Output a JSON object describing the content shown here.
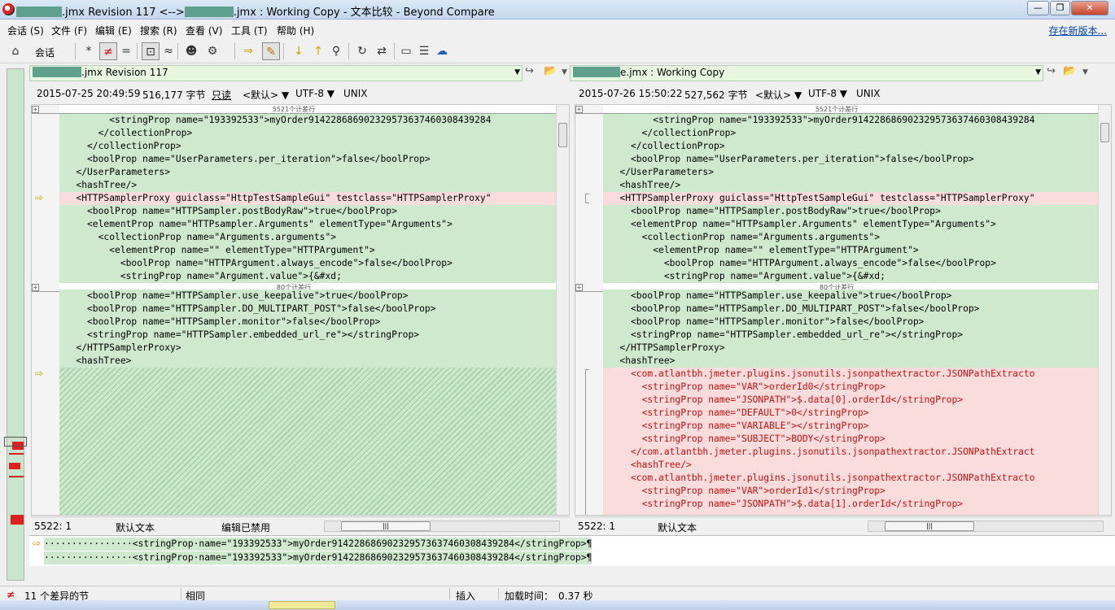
{
  "window": {
    "title": ".jmx Revision 117 <-->",
    "title_mid": ".jmx : Working Copy - 文本比较 - Beyond Compare",
    "btn_min": "—",
    "btn_max": "❐",
    "btn_close": "✕"
  },
  "menu": {
    "items": [
      "会话 (S)",
      "文件 (F)",
      "编辑 (E)",
      "搜索 (R)",
      "查看 (V)",
      "工具 (T)",
      "帮助 (H)"
    ],
    "update_link": "存在新版本..."
  },
  "toolbar": {
    "session_label": "会话",
    "icons": {
      "home": "⌂",
      "all": "*",
      "diffs": "≠",
      "same": "=",
      "context": "⊡",
      "minor": "≈",
      "user": "☻",
      "rules": "⚙",
      "next_section": "⇒",
      "edit": "✎",
      "next_diff": "↓",
      "prev_diff": "↑",
      "find": "⚲",
      "refresh": "↻",
      "swap": "⇄",
      "page1": "▭",
      "page2": "☰",
      "web": "☁"
    }
  },
  "left": {
    "path": ".jmx Revision 117",
    "date": "2015-07-25 20:49:59",
    "size": "516,177 字节",
    "readonly": "只读",
    "format": "<默认>",
    "encoding": "UTF-8",
    "lineend": "UNIX",
    "fold_top": "5521个计差行",
    "fold_mid": "80个计差行",
    "lines": [
      "         <stringProp name=\"193392533\">myOrder914228686902329573637460308439284",
      "       </collectionProp>",
      "     </collectionProp>",
      "     <boolProp name=\"UserParameters.per_iteration\">false</boolProp>",
      "   </UserParameters>",
      "   <hashTree/>",
      "   <HTTPSamplerProxy guiclass=\"HttpTestSampleGui\" testclass=\"HTTPSamplerProxy\"",
      "     <boolProp name=\"HTTPSampler.postBodyRaw\">true</boolProp>",
      "     <elementProp name=\"HTTPsampler.Arguments\" elementType=\"Arguments\">",
      "       <collectionProp name=\"Arguments.arguments\">",
      "         <elementProp name=\"\" elementType=\"HTTPArgument\">",
      "           <boolProp name=\"HTTPArgument.always_encode\">false</boolProp>",
      "           <stringProp name=\"Argument.value\">{&#xd;",
      "     <boolProp name=\"HTTPSampler.use_keepalive\">true</boolProp>",
      "     <boolProp name=\"HTTPSampler.DO_MULTIPART_POST\">false</boolProp>",
      "     <boolProp name=\"HTTPSampler.monitor\">false</boolProp>",
      "     <stringProp name=\"HTTPSampler.embedded_url_re\"></stringProp>",
      "   </HTTPSamplerProxy>",
      "   <hashTree>"
    ],
    "status_pos": "5522: 1",
    "status_mode": "默认文本",
    "status_edit": "编辑已禁用"
  },
  "right": {
    "path": "e.jmx : Working Copy",
    "date": "2015-07-26 15:50:22",
    "size": "527,562 字节",
    "format": "<默认>",
    "encoding": "UTF-8",
    "lineend": "UNIX",
    "fold_top": "5521个计差行",
    "fold_mid": "80个计差行",
    "lines": [
      "         <stringProp name=\"193392533\">myOrder914228686902329573637460308439284",
      "       </collectionProp>",
      "     </collectionProp>",
      "     <boolProp name=\"UserParameters.per_iteration\">false</boolProp>",
      "   </UserParameters>",
      "   <hashTree/>",
      "   <HTTPSamplerProxy guiclass=\"HttpTestSampleGui\" testclass=\"HTTPSamplerProxy\"",
      "     <boolProp name=\"HTTPSampler.postBodyRaw\">true</boolProp>",
      "     <elementProp name=\"HTTPsampler.Arguments\" elementType=\"Arguments\">",
      "       <collectionProp name=\"Arguments.arguments\">",
      "         <elementProp name=\"\" elementType=\"HTTPArgument\">",
      "           <boolProp name=\"HTTPArgument.always_encode\">false</boolProp>",
      "           <stringProp name=\"Argument.value\">{&#xd;",
      "     <boolProp name=\"HTTPSampler.use_keepalive\">true</boolProp>",
      "     <boolProp name=\"HTTPSampler.DO_MULTIPART_POST\">false</boolProp>",
      "     <boolProp name=\"HTTPSampler.monitor\">false</boolProp>",
      "     <stringProp name=\"HTTPSampler.embedded_url_re\"></stringProp>",
      "   </HTTPSamplerProxy>",
      "   <hashTree>",
      "     <com.atlantbh.jmeter.plugins.jsonutils.jsonpathextractor.JSONPathExtracto",
      "       <stringProp name=\"VAR\">orderId0</stringProp>",
      "       <stringProp name=\"JSONPATH\">$.data[0].orderId</stringProp>",
      "       <stringProp name=\"DEFAULT\">0</stringProp>",
      "       <stringProp name=\"VARIABLE\"></stringProp>",
      "       <stringProp name=\"SUBJECT\">BODY</stringProp>",
      "     </com.atlantbh.jmeter.plugins.jsonutils.jsonpathextractor.JSONPathExtract",
      "     <hashTree/>",
      "     <com.atlantbh.jmeter.plugins.jsonutils.jsonpathextractor.JSONPathExtracto",
      "       <stringProp name=\"VAR\">orderId1</stringProp>",
      "       <stringProp name=\"JSONPATH\">$.data[1].orderId</stringProp>"
    ],
    "status_pos": "5522: 1",
    "status_mode": "默认文本"
  },
  "detail": {
    "line1": "················<stringProp·name=\"193392533\">myOrder914228686902329573637460308439284</stringProp>¶",
    "line2": "················<stringProp·name=\"193392533\">myOrder914228686902329573637460308439284</stringProp>¶"
  },
  "status": {
    "diff_icon": "≠",
    "diff_count": "11 个差异的节",
    "same": "相同",
    "insert": "插入",
    "load_label": "加载时间：",
    "load_time": "0.37 秒"
  },
  "colors": {
    "same_bg": "#cfe9cf",
    "diff_bg": "#fbdcdc",
    "orphan_text": "#cc1010",
    "accent_link": "#0645ad"
  }
}
